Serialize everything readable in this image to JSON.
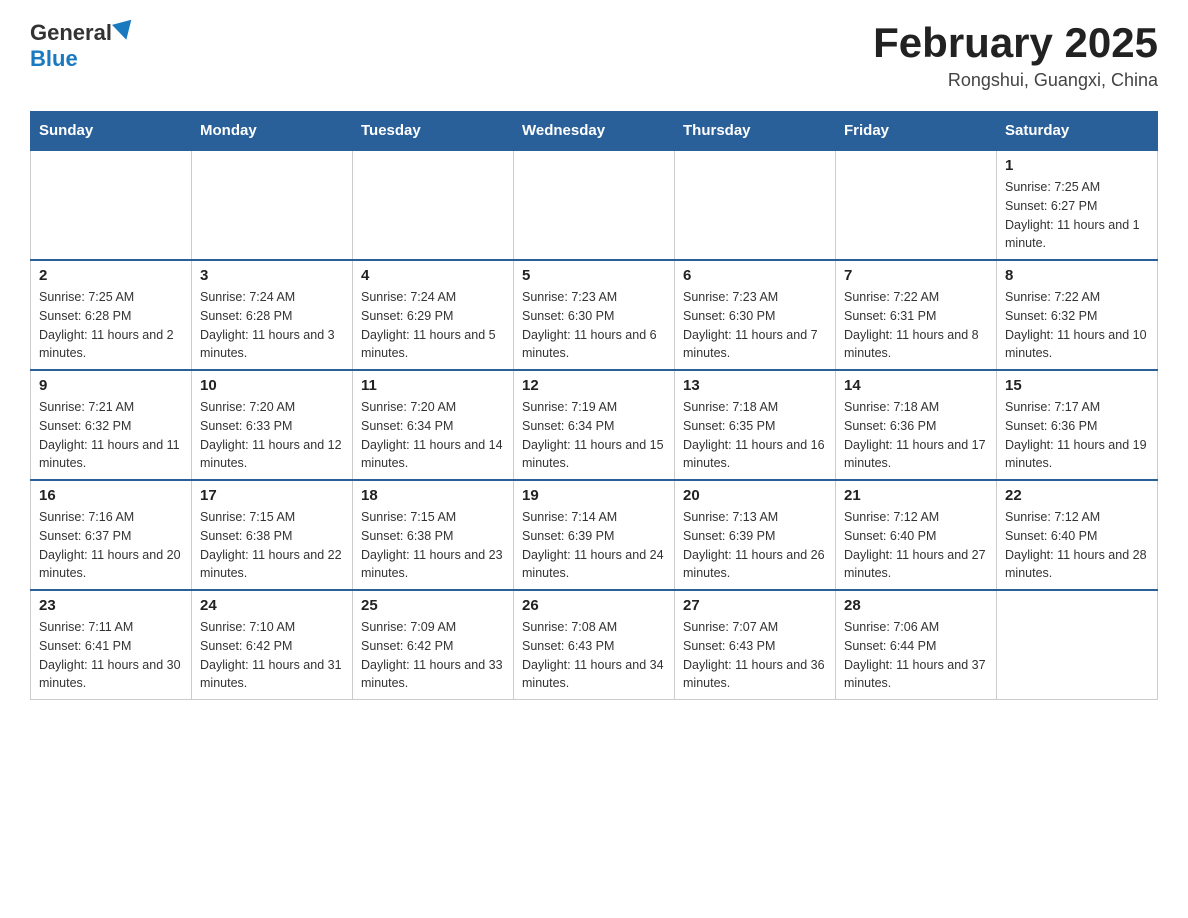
{
  "header": {
    "logo_general": "General",
    "logo_blue": "Blue",
    "title": "February 2025",
    "location": "Rongshui, Guangxi, China"
  },
  "days_of_week": [
    "Sunday",
    "Monday",
    "Tuesday",
    "Wednesday",
    "Thursday",
    "Friday",
    "Saturday"
  ],
  "weeks": [
    [
      {
        "day": "",
        "info": ""
      },
      {
        "day": "",
        "info": ""
      },
      {
        "day": "",
        "info": ""
      },
      {
        "day": "",
        "info": ""
      },
      {
        "day": "",
        "info": ""
      },
      {
        "day": "",
        "info": ""
      },
      {
        "day": "1",
        "info": "Sunrise: 7:25 AM\nSunset: 6:27 PM\nDaylight: 11 hours and 1 minute."
      }
    ],
    [
      {
        "day": "2",
        "info": "Sunrise: 7:25 AM\nSunset: 6:28 PM\nDaylight: 11 hours and 2 minutes."
      },
      {
        "day": "3",
        "info": "Sunrise: 7:24 AM\nSunset: 6:28 PM\nDaylight: 11 hours and 3 minutes."
      },
      {
        "day": "4",
        "info": "Sunrise: 7:24 AM\nSunset: 6:29 PM\nDaylight: 11 hours and 5 minutes."
      },
      {
        "day": "5",
        "info": "Sunrise: 7:23 AM\nSunset: 6:30 PM\nDaylight: 11 hours and 6 minutes."
      },
      {
        "day": "6",
        "info": "Sunrise: 7:23 AM\nSunset: 6:30 PM\nDaylight: 11 hours and 7 minutes."
      },
      {
        "day": "7",
        "info": "Sunrise: 7:22 AM\nSunset: 6:31 PM\nDaylight: 11 hours and 8 minutes."
      },
      {
        "day": "8",
        "info": "Sunrise: 7:22 AM\nSunset: 6:32 PM\nDaylight: 11 hours and 10 minutes."
      }
    ],
    [
      {
        "day": "9",
        "info": "Sunrise: 7:21 AM\nSunset: 6:32 PM\nDaylight: 11 hours and 11 minutes."
      },
      {
        "day": "10",
        "info": "Sunrise: 7:20 AM\nSunset: 6:33 PM\nDaylight: 11 hours and 12 minutes."
      },
      {
        "day": "11",
        "info": "Sunrise: 7:20 AM\nSunset: 6:34 PM\nDaylight: 11 hours and 14 minutes."
      },
      {
        "day": "12",
        "info": "Sunrise: 7:19 AM\nSunset: 6:34 PM\nDaylight: 11 hours and 15 minutes."
      },
      {
        "day": "13",
        "info": "Sunrise: 7:18 AM\nSunset: 6:35 PM\nDaylight: 11 hours and 16 minutes."
      },
      {
        "day": "14",
        "info": "Sunrise: 7:18 AM\nSunset: 6:36 PM\nDaylight: 11 hours and 17 minutes."
      },
      {
        "day": "15",
        "info": "Sunrise: 7:17 AM\nSunset: 6:36 PM\nDaylight: 11 hours and 19 minutes."
      }
    ],
    [
      {
        "day": "16",
        "info": "Sunrise: 7:16 AM\nSunset: 6:37 PM\nDaylight: 11 hours and 20 minutes."
      },
      {
        "day": "17",
        "info": "Sunrise: 7:15 AM\nSunset: 6:38 PM\nDaylight: 11 hours and 22 minutes."
      },
      {
        "day": "18",
        "info": "Sunrise: 7:15 AM\nSunset: 6:38 PM\nDaylight: 11 hours and 23 minutes."
      },
      {
        "day": "19",
        "info": "Sunrise: 7:14 AM\nSunset: 6:39 PM\nDaylight: 11 hours and 24 minutes."
      },
      {
        "day": "20",
        "info": "Sunrise: 7:13 AM\nSunset: 6:39 PM\nDaylight: 11 hours and 26 minutes."
      },
      {
        "day": "21",
        "info": "Sunrise: 7:12 AM\nSunset: 6:40 PM\nDaylight: 11 hours and 27 minutes."
      },
      {
        "day": "22",
        "info": "Sunrise: 7:12 AM\nSunset: 6:40 PM\nDaylight: 11 hours and 28 minutes."
      }
    ],
    [
      {
        "day": "23",
        "info": "Sunrise: 7:11 AM\nSunset: 6:41 PM\nDaylight: 11 hours and 30 minutes."
      },
      {
        "day": "24",
        "info": "Sunrise: 7:10 AM\nSunset: 6:42 PM\nDaylight: 11 hours and 31 minutes."
      },
      {
        "day": "25",
        "info": "Sunrise: 7:09 AM\nSunset: 6:42 PM\nDaylight: 11 hours and 33 minutes."
      },
      {
        "day": "26",
        "info": "Sunrise: 7:08 AM\nSunset: 6:43 PM\nDaylight: 11 hours and 34 minutes."
      },
      {
        "day": "27",
        "info": "Sunrise: 7:07 AM\nSunset: 6:43 PM\nDaylight: 11 hours and 36 minutes."
      },
      {
        "day": "28",
        "info": "Sunrise: 7:06 AM\nSunset: 6:44 PM\nDaylight: 11 hours and 37 minutes."
      },
      {
        "day": "",
        "info": ""
      }
    ]
  ]
}
